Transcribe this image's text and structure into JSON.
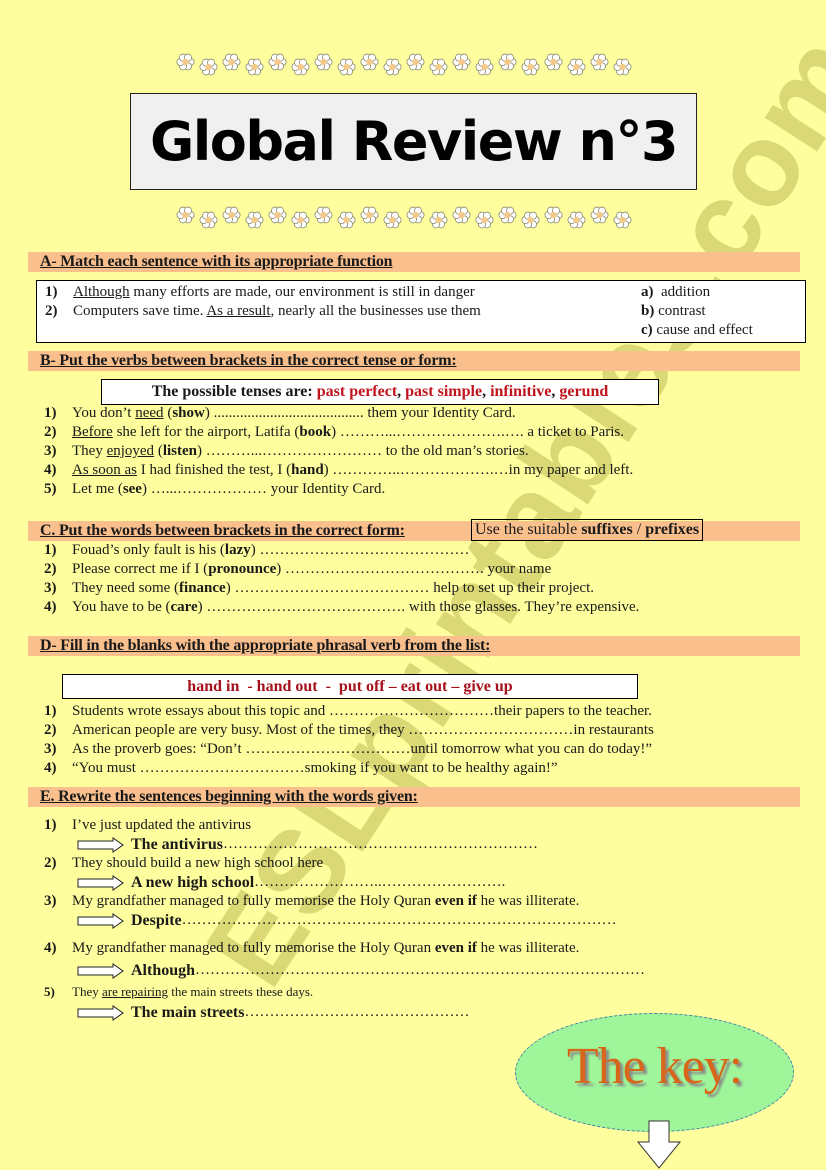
{
  "title": "Global Review n°3",
  "watermark": "ESLprintables.com",
  "colors": {
    "page_bg": "#fffe9e",
    "section_header_bg": "#f9bf8c",
    "tense_red": "#c0141c",
    "phrasal_red": "#a5101a",
    "key_ellipse": "#9ef59a",
    "key_text": "#d8661a"
  },
  "sectionA": {
    "heading": "A- Match each sentence with its appropriate function",
    "items": [
      {
        "num": "1)",
        "underlined": "Although",
        "rest": " many efforts are made, our environment is still in danger"
      },
      {
        "num": "2)",
        "pre": "Computers save time. ",
        "underlined": "As a result",
        "rest": ", nearly all the businesses use them"
      }
    ],
    "functions": [
      {
        "letter": "a)",
        "label": "addition"
      },
      {
        "letter": "b)",
        "label": "contrast"
      },
      {
        "letter": "c)",
        "label": "cause and effect"
      }
    ]
  },
  "sectionB": {
    "heading": "B- Put the verbs between brackets in the correct tense or form:",
    "tenses_intro": "The possible tenses are: ",
    "tenses": [
      "past perfect",
      "past simple",
      "infinitive",
      "gerund"
    ],
    "items": [
      {
        "num": "1)",
        "pre": "You don’t ",
        "underlined": "need",
        "mid": " (",
        "verb": "show",
        "post": ") ........................................ them your Identity Card."
      },
      {
        "num": "2)",
        "underlined": "Before",
        "mid": " she left for the airport, Latifa (",
        "verb": "book",
        "post": ") ………...………………….…. a ticket to Paris."
      },
      {
        "num": "3)",
        "pre": "They ",
        "underlined": "enjoyed",
        "mid": " (",
        "verb": "listen",
        "post": ") ………...…………………… to the old man’s stories."
      },
      {
        "num": "4)",
        "underlined": "As soon as",
        "mid": " I had finished the test, I (",
        "verb": "hand",
        "post": ") …………..……………….…in my paper and left."
      },
      {
        "num": "5)",
        "pre": "Let me (",
        "verb": "see",
        "post": ") …...……………… your Identity Card."
      }
    ]
  },
  "sectionC": {
    "heading": "C. Put the words between brackets in the correct form:",
    "note_pre": "Use the suitable ",
    "note_bold1": "suffixes",
    "note_sep": " / ",
    "note_bold2": "prefixes",
    "items": [
      {
        "num": "1)",
        "pre": "Fouad’s only fault is his (",
        "word": "lazy",
        "post": ") ……………………………………"
      },
      {
        "num": "2)",
        "pre": "Please correct me if I (",
        "word": "pronounce",
        "post": ") …………………………………. your name"
      },
      {
        "num": "3)",
        "pre": "They need some (",
        "word": "finance",
        "post": ") ………………………………… help to set up their project."
      },
      {
        "num": "4)",
        "pre": "You have to be (",
        "word": "care",
        "post": ") …………………………………. with those glasses. They’re expensive."
      }
    ]
  },
  "sectionD": {
    "heading": "D- Fill in the blanks with the appropriate phrasal verb from the list:",
    "list": "hand in  - hand out  -  put off – eat out – give up",
    "items": [
      {
        "num": "1)",
        "text": "Students wrote essays about this topic and ……………………………their papers to the teacher."
      },
      {
        "num": "2)",
        "text": "American people are very busy. Most of the times, they ……………………………in restaurants"
      },
      {
        "num": "3)",
        "text": "As the proverb goes: “Don’t ……………………………until tomorrow what you can do today!”"
      },
      {
        "num": "4)",
        "text": "“You must ……………………………smoking if you want to be healthy again!”"
      }
    ]
  },
  "sectionE": {
    "heading": "E. Rewrite the sentences beginning with the words given:",
    "items": [
      {
        "num": "1)",
        "sentence": "I’ve just updated the antivirus",
        "lead": "The antivirus",
        "dots": " ………………………………………………………"
      },
      {
        "num": "2)",
        "sentence": "They should build a new high school here",
        "lead": "A new high school",
        "dots": " ……………………..……………………."
      },
      {
        "num": "3)",
        "pre": "My grandfather managed to fully memorise the Holy Quran ",
        "bold": "even if",
        "post": " he was illiterate.",
        "lead": "Despite",
        "dots": " ……………………………………………………………………………"
      },
      {
        "num": "4)",
        "pre": "My grandfather managed to fully memorise the Holy Quran ",
        "bold": "even if",
        "post": " he was illiterate.",
        "lead": "Although",
        "dots": " ………………………………………………………………………………"
      },
      {
        "num": "5)",
        "pre": "They ",
        "underlined": "are repairing",
        "post": " the main streets these days.",
        "lead": "The main streets",
        "dots": "………………………………………"
      }
    ]
  },
  "key": {
    "label": "The key:"
  }
}
